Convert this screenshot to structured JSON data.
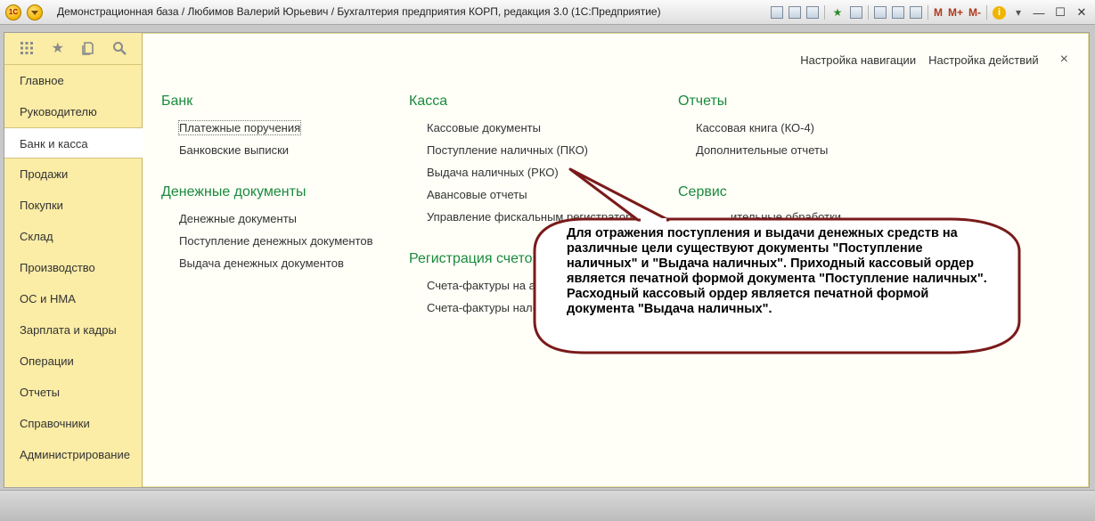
{
  "titlebar": {
    "logo": "1С",
    "title": "Демонстрационная база / Любимов Валерий Юрьевич / Бухгалтерия предприятия КОРП, редакция 3.0  (1С:Предприятие)",
    "m_labels": [
      "M",
      "M+",
      "M-"
    ],
    "info": "i"
  },
  "sidebar": {
    "tools": [
      "apps-grid-icon",
      "star-icon",
      "history-icon",
      "search-icon"
    ],
    "items": [
      {
        "label": "Главное",
        "active": false
      },
      {
        "label": "Руководителю",
        "active": false
      },
      {
        "label": "Банк и касса",
        "active": true
      },
      {
        "label": "Продажи",
        "active": false
      },
      {
        "label": "Покупки",
        "active": false
      },
      {
        "label": "Склад",
        "active": false
      },
      {
        "label": "Производство",
        "active": false
      },
      {
        "label": "ОС и НМА",
        "active": false
      },
      {
        "label": "Зарплата и кадры",
        "active": false
      },
      {
        "label": "Операции",
        "active": false
      },
      {
        "label": "Отчеты",
        "active": false
      },
      {
        "label": "Справочники",
        "active": false
      },
      {
        "label": "Администрирование",
        "active": false
      }
    ]
  },
  "content": {
    "nav_settings": "Настройка навигации",
    "action_settings": "Настройка действий",
    "close": "×",
    "sections": {
      "bank": {
        "title": "Банк",
        "links": [
          "Платежные поручения",
          "Банковские выписки"
        ]
      },
      "money_docs": {
        "title": "Денежные документы",
        "links": [
          "Денежные документы",
          "Поступление денежных документов",
          "Выдача денежных документов"
        ]
      },
      "kassa": {
        "title": "Касса",
        "links": [
          "Кассовые документы",
          "Поступление наличных (ПКО)",
          "Выдача наличных (РКО)",
          "Авансовые отчеты",
          "Управление фискальным регистратором"
        ]
      },
      "invoices": {
        "title": "Регистрация счетов",
        "links": [
          "Счета-фактуры на а",
          "Счета-фактуры нало"
        ]
      },
      "reports": {
        "title": "Отчеты",
        "links": [
          "Кассовая книга (КО-4)",
          "Дополнительные отчеты"
        ]
      },
      "service": {
        "title": "Сервис",
        "links": [
          "ительные обработки"
        ]
      }
    }
  },
  "callout": {
    "text": "Для отражения поступления и выдачи денежных средств на различные цели существуют документы \"Поступление наличных\" и \"Выдача наличных\". Приходный кассовый ордер является печатной формой документа \"Поступление наличных\". Расходный кассовый ордер является печатной формой документа \"Выдача наличных\".",
    "border_color": "#7a1a1a"
  },
  "colors": {
    "section_heading": "#1a8a3c",
    "sidebar_bg": "#fbeca6"
  }
}
